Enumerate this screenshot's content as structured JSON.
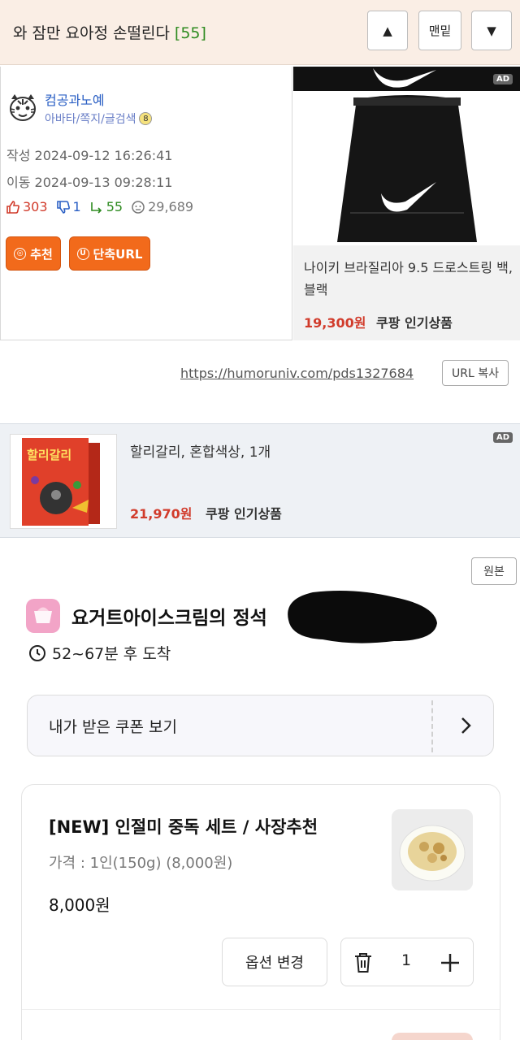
{
  "topbar": {
    "title": "와 잠만 요아정 손떨린다",
    "reply_count": "[55]",
    "up_label": "▲",
    "bottom_label": "맨밑",
    "down_label": "▼"
  },
  "author": {
    "nickname": "컴공과노예",
    "submenu": "아바타/쪽지/글검색",
    "created": "작성 2024-09-12 16:26:41",
    "moved": "이동 2024-09-13 09:28:11",
    "stats": {
      "up": "303",
      "down": "1",
      "replies": "55",
      "views": "29,689"
    },
    "recommend_label": "추천",
    "shorturl_label": "단축URL"
  },
  "ad_nike": {
    "badge": "AD",
    "name": "나이키 브라질리아 9.5 드로스트링 백, 블랙",
    "price": "19,300원",
    "tag": "쿠팡 인기상품"
  },
  "url": {
    "link": "https://humoruniv.com/pds1327684",
    "copy_label": "URL 복사"
  },
  "ad_halli": {
    "badge": "AD",
    "name": "할리갈리, 혼합색상, 1개",
    "price": "21,970원",
    "tag": "쿠팡 인기상품",
    "box_text": "할리갈리"
  },
  "original_label": "원본",
  "app": {
    "shop_name": "요거트아이스크림의 정석",
    "eta": "52~67분 후 도착",
    "coupon_label": "내가 받은 쿠폰 보기",
    "item": {
      "name": "[NEW] 인절미 중독 세트 / 사장추천",
      "option": "가격 : 1인(150g) (8,000원)",
      "price": "8,000원",
      "option_change_label": "옵션 변경",
      "quantity": "1"
    }
  },
  "colors": {
    "topbar_bg": "#faeee5",
    "reply_count": "#2e8b20",
    "orange_button": "#f26a1b",
    "price_red": "#d13b2b",
    "link_blue": "#2a5fc4"
  }
}
